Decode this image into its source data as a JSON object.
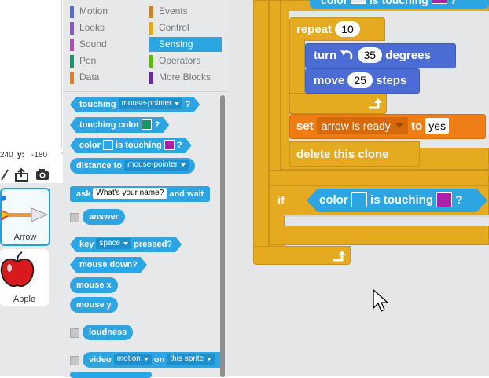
{
  "coords": {
    "x_value": "240",
    "y_label": "y:",
    "y_value": "-180"
  },
  "sprites": [
    {
      "name": "Arrow",
      "selected": true
    },
    {
      "name": "Apple",
      "selected": false
    }
  ],
  "categories": [
    {
      "label": "Motion",
      "color": "#4a6cd4"
    },
    {
      "label": "Events",
      "color": "#c88330"
    },
    {
      "label": "Looks",
      "color": "#8a55d7"
    },
    {
      "label": "Control",
      "color": "#e1a91a"
    },
    {
      "label": "Sound",
      "color": "#bb42c3"
    },
    {
      "label": "Sensing",
      "color": "#2ca5e2"
    },
    {
      "label": "Pen",
      "color": "#0e9a6c"
    },
    {
      "label": "Operators",
      "color": "#5cb712"
    },
    {
      "label": "Data",
      "color": "#ee7d16"
    },
    {
      "label": "More Blocks",
      "color": "#632d99"
    }
  ],
  "palette": {
    "touching": {
      "label": "touching",
      "dropdown": "mouse-pointer",
      "q": "?"
    },
    "touching_color": {
      "label": "touching color",
      "q": "?",
      "swatch": "#0e9a6c"
    },
    "color_touching": {
      "label_a": "color",
      "label_b": "is touching",
      "q": "?",
      "swatch_a": "#2ca5e2",
      "swatch_b": "#b01fa8"
    },
    "distance_to": {
      "label": "distance to",
      "dropdown": "mouse-pointer"
    },
    "ask": {
      "label": "ask",
      "input": "What's your name?",
      "tail": "and wait"
    },
    "answer": {
      "label": "answer"
    },
    "key_pressed": {
      "label": "key",
      "dropdown": "space",
      "tail": "pressed?"
    },
    "mouse_down": {
      "label": "mouse down?"
    },
    "mouse_x": {
      "label": "mouse x"
    },
    "mouse_y": {
      "label": "mouse y"
    },
    "loudness": {
      "label": "loudness"
    },
    "video": {
      "label": "video",
      "dropdown_a": "motion",
      "mid": "on",
      "dropdown_b": "this sprite"
    }
  },
  "script": {
    "top_color": {
      "label_a": "color",
      "label_b": "is touching",
      "q": "?"
    },
    "repeat": {
      "label": "repeat",
      "value": "10"
    },
    "turn": {
      "label": "turn",
      "value": "35",
      "tail": "degrees"
    },
    "move": {
      "label": "move",
      "value": "25",
      "tail": "steps"
    },
    "set": {
      "label": "set",
      "variable": "arrow is ready",
      "to": "to",
      "value": "yes"
    },
    "delete": {
      "label": "delete this clone"
    },
    "if": {
      "label": "if"
    },
    "if_cond": {
      "label_a": "color",
      "label_b": "is touching",
      "q": "?",
      "swatch_a": "#2ca5e2",
      "swatch_b": "#b01fa8"
    }
  }
}
